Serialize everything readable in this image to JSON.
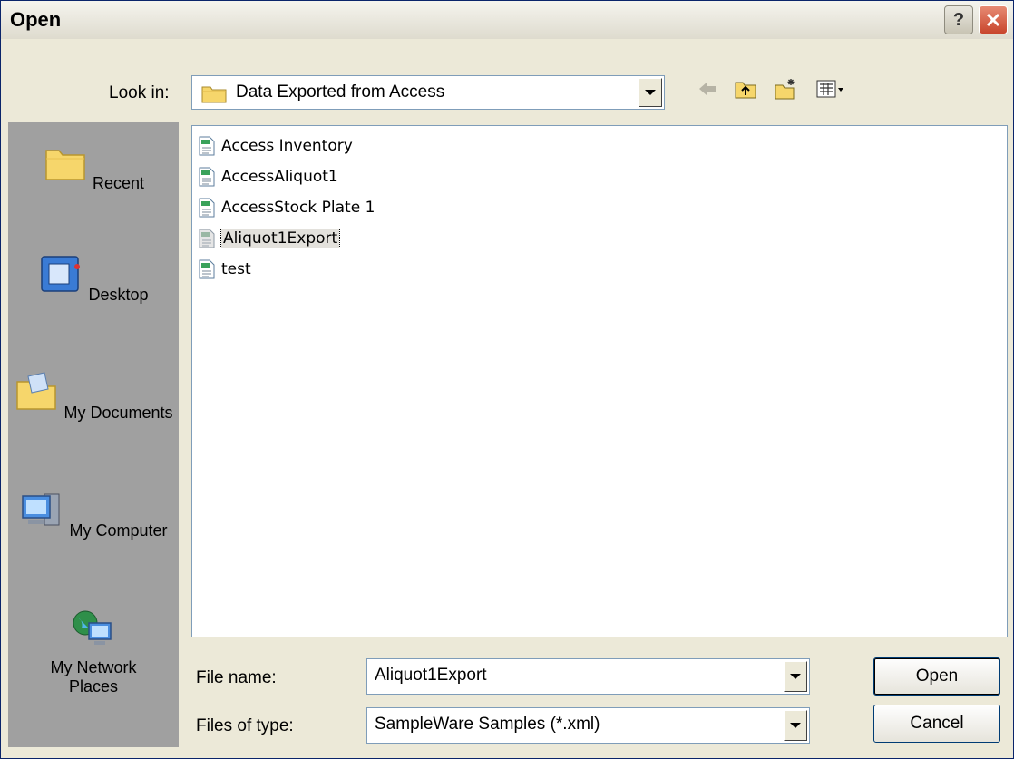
{
  "window": {
    "title": "Open"
  },
  "lookin": {
    "label": "Look in:",
    "value": "Data Exported from Access"
  },
  "places": [
    {
      "label": "Recent",
      "icon": "recent-folder-icon"
    },
    {
      "label": "Desktop",
      "icon": "desktop-icon"
    },
    {
      "label": "My Documents",
      "icon": "my-documents-icon"
    },
    {
      "label": "My Computer",
      "icon": "my-computer-icon"
    },
    {
      "label_line1": "My Network",
      "label_line2": "Places",
      "icon": "network-places-icon"
    }
  ],
  "files": [
    {
      "name": "Access Inventory"
    },
    {
      "name": "AccessAliquot1"
    },
    {
      "name": "AccessStock Plate 1"
    },
    {
      "name": "Aliquot1Export",
      "selected": true
    },
    {
      "name": "test"
    }
  ],
  "filename": {
    "label": "File name:",
    "value": "Aliquot1Export"
  },
  "filetype": {
    "label": "Files of type:",
    "value": "SampleWare Samples (*.xml)"
  },
  "buttons": {
    "open": "Open",
    "cancel": "Cancel"
  },
  "colors": {
    "selection": "#e3e1dc",
    "background": "#ece9d8",
    "places_bar": "#a0a0a0"
  }
}
